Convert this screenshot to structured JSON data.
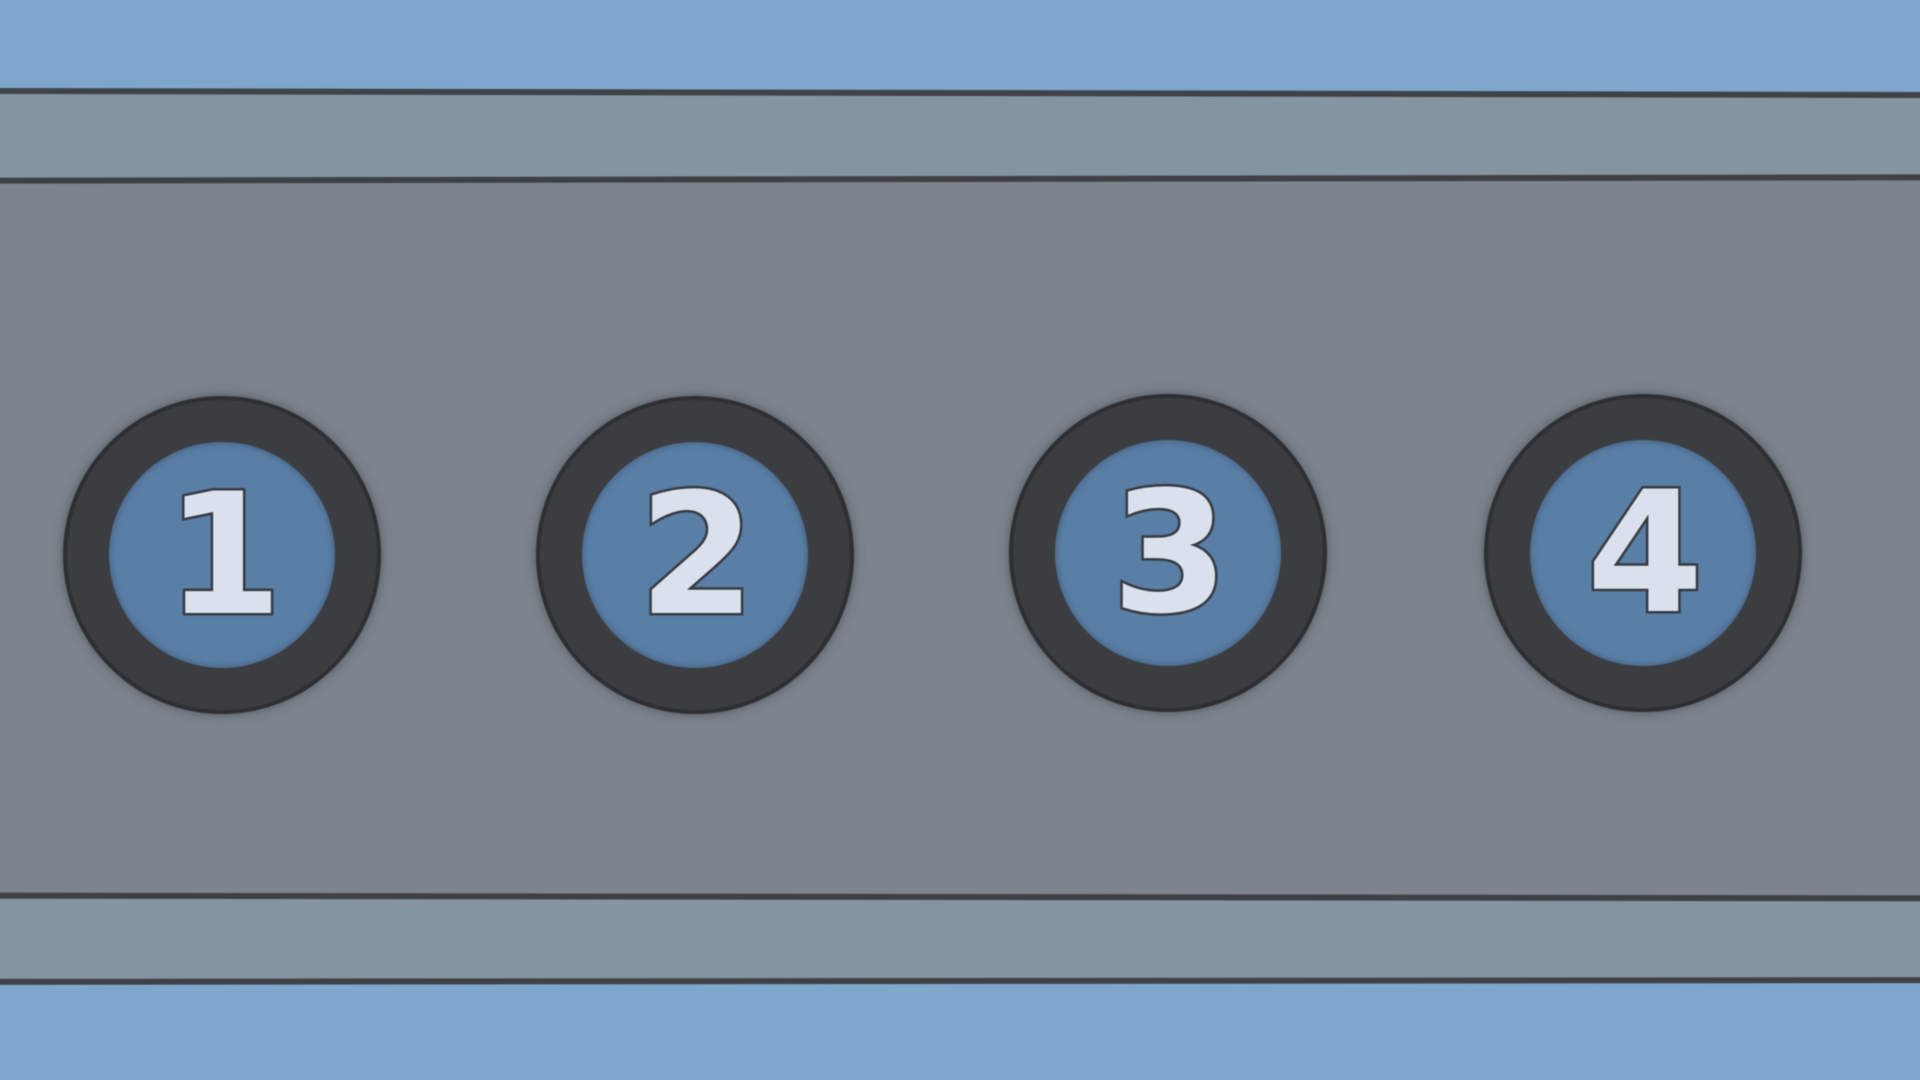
{
  "level_select": {
    "buttons": [
      {
        "label": "1"
      },
      {
        "label": "2"
      },
      {
        "label": "3"
      },
      {
        "label": "4"
      }
    ]
  },
  "colors": {
    "sky": "#7fa7cc",
    "rail": "#8494a0",
    "panel": "#7d848d",
    "button_ring": "#3c3d41",
    "button_face": "#5a7fa6",
    "button_text": "#d9e2ec",
    "outline": "#3a3b3f"
  }
}
